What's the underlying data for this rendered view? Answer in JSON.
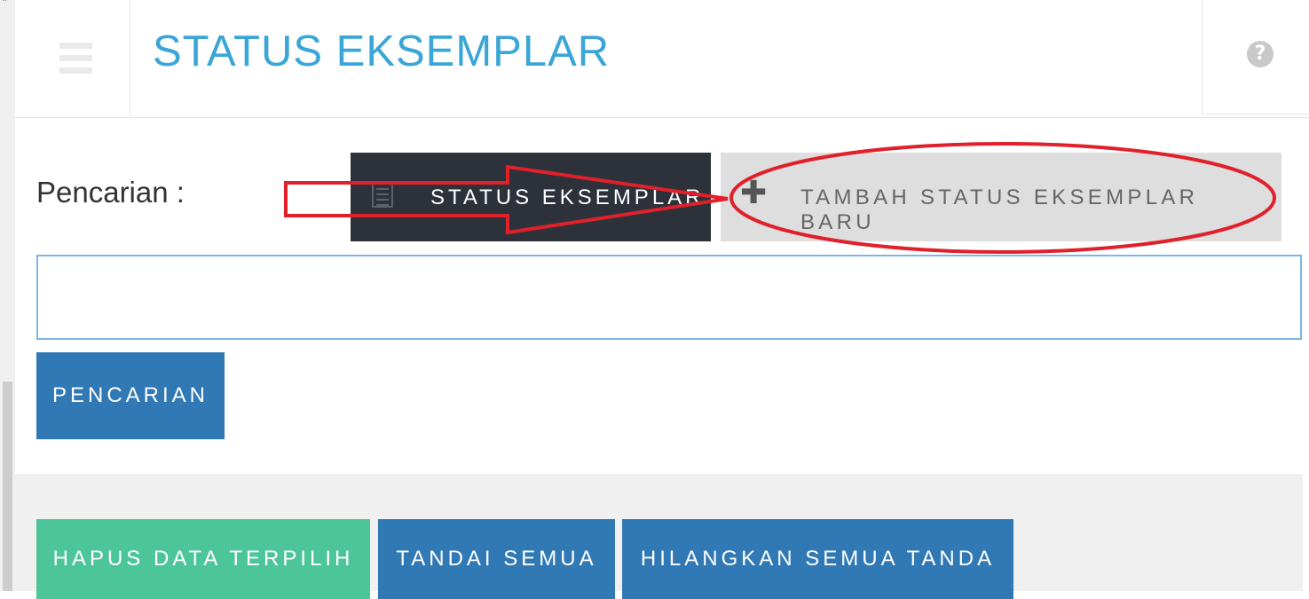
{
  "header": {
    "title": "STATUS EKSEMPLAR",
    "menu_icon": "hamburger-menu-icon",
    "help_icon": "question-circle-icon",
    "help_glyph": "?"
  },
  "search": {
    "label": "Pencarian :",
    "input_value": "",
    "button_label": "PENCARIAN"
  },
  "tabs": [
    {
      "label": "STATUS EKSEMPLAR",
      "icon": "list-icon",
      "active": true
    },
    {
      "label": "TAMBAH STATUS EKSEMPLAR BARU",
      "icon": "plus-icon",
      "glyph": "✚",
      "active": false
    }
  ],
  "actions": {
    "delete_label": "HAPUS DATA TERPILIH",
    "mark_all_label": "TANDAI SEMUA",
    "unmark_all_label": "HILANGKAN SEMUA TANDA"
  },
  "colors": {
    "title": "#3aa6d8",
    "active_tab_bg": "#2d323a",
    "inactive_tab_bg": "#dedede",
    "primary_button": "#3079b5",
    "success_button": "#4dc59a",
    "annotation": "#e0202a"
  },
  "scrollbar": {
    "up_glyph": "˄"
  }
}
